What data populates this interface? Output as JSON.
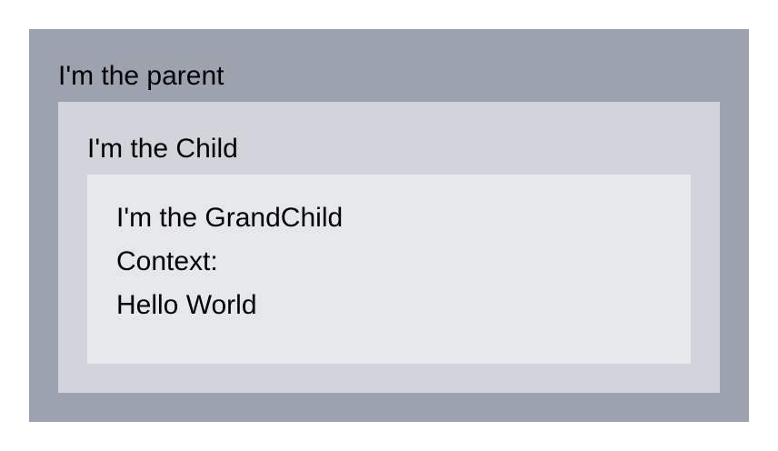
{
  "colors": {
    "parent_background": "#9ca3af",
    "child_background": "#d1d5db",
    "grandchild_background": "#e5e7eb",
    "text": "#000000"
  },
  "parent": {
    "label": "I'm the parent"
  },
  "child": {
    "label": "I'm the Child"
  },
  "grandchild": {
    "label": "I'm the GrandChild",
    "context_label": "Context:",
    "context_value": "Hello World"
  }
}
